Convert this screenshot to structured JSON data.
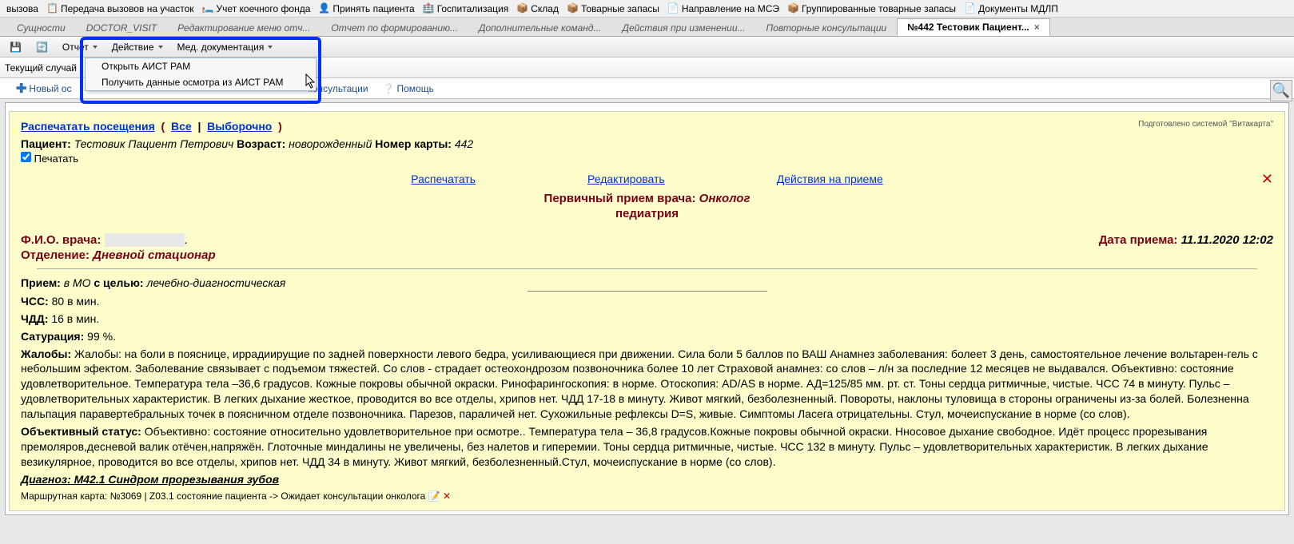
{
  "top_menu": {
    "i0": "вызова",
    "i1": "Передача вызовов на участок",
    "i2": "Учет коечного фонда",
    "i3": "Принять пациента",
    "i4": "Госпитализация",
    "i5": "Склад",
    "i6": "Товарные запасы",
    "i7": "Направление на МСЭ",
    "i8": "Группированные товарные запасы",
    "i9": "Документы МДЛП"
  },
  "tabs": {
    "t0": "Сущности",
    "t1": "DOCTOR_VISIT",
    "t2": "Редактирование меню отч...",
    "t3": "Отчет по формированию...",
    "t4": "Дополнительные команд...",
    "t5": "Действия при изменении...",
    "t6": "Повторные консультации",
    "t7": "№442 Тестовик Пациент..."
  },
  "actionbar": {
    "report": "Отчет",
    "action": "Действие",
    "meddoc": "Мед. документация"
  },
  "dropdown": {
    "i0": "Открыть АИСТ РАМ",
    "i1": "Получить данные осмотра из АИСТ РАМ"
  },
  "second_bar": "Текущий случай",
  "subtoolbar": {
    "new_osm": "Новый ос",
    "consult": "консультации",
    "help": "Помощь"
  },
  "doc": {
    "print_visits": "Распечатать посещения",
    "all": "Все",
    "selective": "Выборочно",
    "watermark": "Подготовлено системой \"Витакарта\"",
    "patient_label": "Пациент:",
    "patient_name": "Тестовик Пациент Петрович",
    "age_label": "Возраст:",
    "age_value": "новорожденный",
    "card_label": "Номер карты:",
    "card_value": "442",
    "print_chk": "Печатать",
    "link_print": "Распечатать",
    "link_edit": "Редактировать",
    "link_actions": "Действия на приеме",
    "title_prefix": "Первичный прием врача: ",
    "title_spec": "Онколог",
    "subtitle": "педиатрия",
    "doctor_label": "Ф.И.О. врача:",
    "doctor_name": "",
    "date_label": "Дата приема:",
    "date_value": "11.11.2020 12:02",
    "dept_label": "Отделение:",
    "dept_value": "Дневной стационар",
    "visit_label": "Прием:",
    "visit_where": "в МО",
    "purpose_label": "с целью:",
    "purpose_value": "лечебно-диагностическая",
    "hr_label": "ЧСС:",
    "hr_value": "80 в мин.",
    "br_label": "ЧДД:",
    "br_value": "16 в мин.",
    "sat_label": "Сатурация:",
    "sat_value": "99 %.",
    "complaints_label": "Жалобы:",
    "complaints_value": "Жалобы: на боли в пояснице, иррадиирущие по задней поверхности левого бедра, усиливающиеся при движении. Сила боли 5 баллов по ВАШ Анамнез заболевания: болеет 3 день, самостоятельное лечение вольтарен-гель с небольшим эфектом. Заболевание связывает с подъемом тяжестей. Со слов - страдает остеохондрозом позвоночника более 10 лет Страховой анамнез: со слов – л/н за последние 12 месяцев не выдавался. Объективно: состояние удовлетворительное. Температура тела –36,6 градусов. Кожные покровы обычной окраски. Ринофарингоскопия: в норме. Отоскопия: AD/AS в норме. АД=125/85 мм. рт. ст. Тоны сердца ритмичные, чистые. ЧСС 74 в минуту. Пульс – удовлетворительных характеристик. В легких дыхание жесткое, проводится во все отделы, хрипов нет. ЧДД 17-18 в минуту. Живот мягкий, безболезненный. Повороты, наклоны туловища в стороны ограничены из-за болей. Болезненна пальпация паравертебральных точек в поясничном отделе позвоночника. Парезов, параличей нет. Сухожильные рефлексы D=S, живые. Симптомы Ласега отрицательны. Стул, мочеиспускание в норме (со слов).",
    "obj_label": "Объективный статус:",
    "obj_value": "Объективно: состояние относительно удовлетворительное при осмотре.. Температура тела – 36,8 градусов.Кожные покровы обычной окраски. Нносовое дыхание свободное. Идёт процесс прорезывания премоляров,десневой валик отёчен,напряжён. Глоточные миндалины не увеличены, без налетов и гиперемии. Тоны сердца ритмичные, чистые. ЧСС 132 в минуту. Пульс – удовлетворительных характеристик. В легких дыхание везикулярное, проводится во все отделы, хрипов нет. ЧДД 34 в минуту. Живот мягкий, безболезненный.Стул, мочеиспускание в норме (со слов).",
    "diag_label": "Диагноз:",
    "diag_value": "M42.1 Синдром прорезывания зубов",
    "route": "Маршрутная карта: №3069 | Z03.1 состояние пациента -> Ожидает консультации онколога"
  }
}
